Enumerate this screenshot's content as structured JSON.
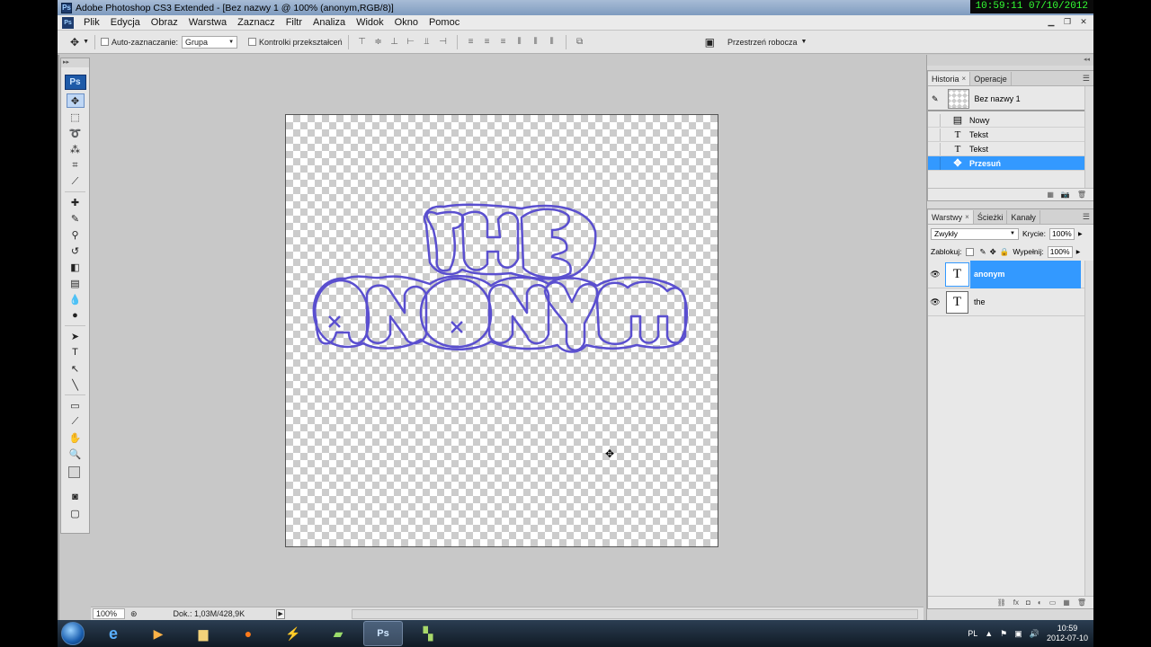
{
  "window": {
    "title": "Adobe Photoshop CS3 Extended - [Bez nazwy 1 @ 100% (anonym,RGB/8)]",
    "app_icon": "Ps",
    "overlay_clock": "10:59:11  07/10/2012"
  },
  "menu": [
    "Plik",
    "Edycja",
    "Obraz",
    "Warstwa",
    "Zaznacz",
    "Filtr",
    "Analiza",
    "Widok",
    "Okno",
    "Pomoc"
  ],
  "options": {
    "auto_select_label": "Auto-zaznaczanie:",
    "auto_select_value": "Grupa",
    "transform_controls_label": "Kontrolki przekształceń",
    "workspace_label": "Przestrzeń robocza"
  },
  "toolbox": {
    "logo": "Ps"
  },
  "canvas": {
    "text_line1": "THE",
    "text_line2": "ANONYM",
    "outline_color": "#5a4fcf"
  },
  "status": {
    "zoom": "100%",
    "doc": "Dok.: 1,03M/428,9K"
  },
  "history_panel": {
    "tabs": [
      "Historia",
      "Operacje"
    ],
    "snapshot_name": "Bez nazwy 1",
    "items": [
      {
        "label": "Nowy",
        "icon": "document-icon",
        "selected": false
      },
      {
        "label": "Tekst",
        "icon": "text-tool-icon",
        "selected": false
      },
      {
        "label": "Tekst",
        "icon": "text-tool-icon",
        "selected": false
      },
      {
        "label": "Przesuń",
        "icon": "move-tool-icon",
        "selected": true
      }
    ]
  },
  "layers_panel": {
    "tabs": [
      "Warstwy",
      "Ścieżki",
      "Kanały"
    ],
    "blend_mode": "Zwykły",
    "opacity_label": "Krycie:",
    "opacity_value": "100%",
    "lock_label": "Zablokuj:",
    "fill_label": "Wypełnij:",
    "fill_value": "100%",
    "layers": [
      {
        "name": "anonym",
        "thumb": "T",
        "selected": true
      },
      {
        "name": "the",
        "thumb": "T",
        "selected": false
      }
    ]
  },
  "taskbar": {
    "lang": "PL",
    "time": "10:59",
    "date": "2012-07-10",
    "active_app": "Ps"
  }
}
